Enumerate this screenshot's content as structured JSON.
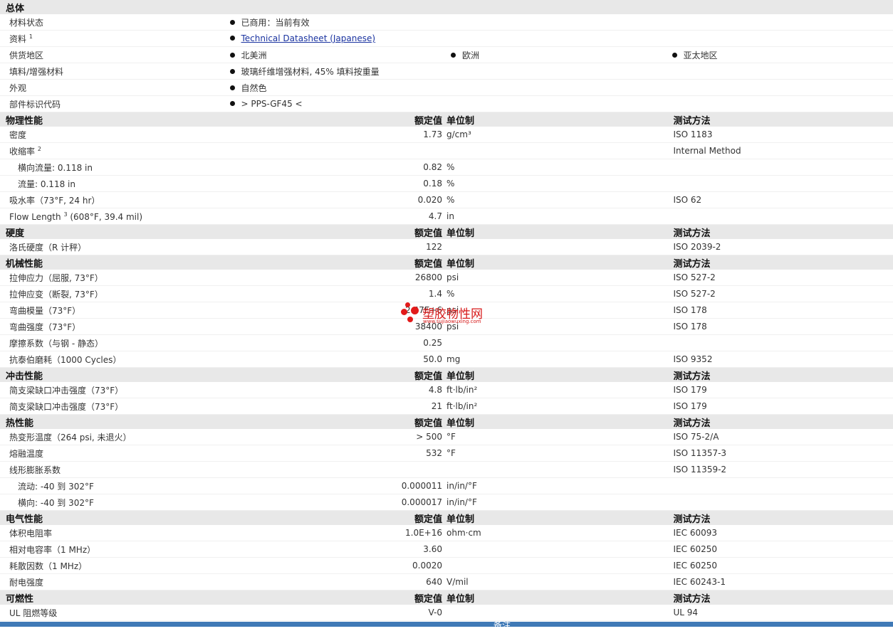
{
  "general": {
    "title": "总体",
    "rows": [
      {
        "label": "材料状态",
        "value": "已商用：当前有效"
      },
      {
        "label": "资料",
        "sup": "1",
        "link": "Technical Datasheet (Japanese)"
      },
      {
        "label": "供货地区",
        "regions": [
          "北美洲",
          "欧洲",
          "亚太地区"
        ]
      },
      {
        "label": "填料/增强材料",
        "value": "玻璃纤维增强材料, 45% 填料按重量"
      },
      {
        "label": "外观",
        "value": "自然色"
      },
      {
        "label": "部件标识代码",
        "value": "> PPS-GF45 <"
      }
    ]
  },
  "headers": {
    "value": "额定值",
    "unit": "单位制",
    "method": "测试方法"
  },
  "sections": [
    {
      "title": "物理性能",
      "rows": [
        {
          "label": "密度",
          "value": "1.73",
          "unit": "g/cm³",
          "method": "ISO 1183"
        },
        {
          "label": "收缩率",
          "sup": "2",
          "value": "",
          "unit": "",
          "method": "Internal Method"
        },
        {
          "label": "横向流量: 0.118 in",
          "indent": true,
          "value": "0.82",
          "unit": "%",
          "method": ""
        },
        {
          "label": "流量: 0.118 in",
          "indent": true,
          "value": "0.18",
          "unit": "%",
          "method": ""
        },
        {
          "label": "吸水率（73°F, 24 hr）",
          "value": "0.020",
          "unit": "%",
          "method": "ISO 62"
        },
        {
          "label": "Flow Length",
          "sup": "3",
          "suffix": " (608°F, 39.4 mil)",
          "value": "4.7",
          "unit": "in",
          "method": ""
        }
      ]
    },
    {
      "title": "硬度",
      "rows": [
        {
          "label": "洛氏硬度（R 计秤）",
          "value": "122",
          "unit": "",
          "method": "ISO 2039-2"
        }
      ]
    },
    {
      "title": "机械性能",
      "rows": [
        {
          "label": "拉伸应力（屈服, 73°F）",
          "value": "26800",
          "unit": "psi",
          "method": "ISO 527-2"
        },
        {
          "label": "拉伸应变（断裂, 73°F）",
          "value": "1.4",
          "unit": "%",
          "method": "ISO 527-2"
        },
        {
          "label": "弯曲模量（73°F）",
          "value": "2.47E+6",
          "unit": "psi",
          "method": "ISO 178"
        },
        {
          "label": "弯曲强度（73°F）",
          "value": "38400",
          "unit": "psi",
          "method": "ISO 178"
        },
        {
          "label": "摩擦系数（与钢 - 静态）",
          "value": "0.25",
          "unit": "",
          "method": ""
        },
        {
          "label": "抗泰伯磨耗（1000 Cycles）",
          "value": "50.0",
          "unit": "mg",
          "method": "ISO 9352"
        }
      ]
    },
    {
      "title": "冲击性能",
      "rows": [
        {
          "label": "简支梁缺口冲击强度（73°F）",
          "value": "4.8",
          "unit": "ft·lb/in²",
          "method": "ISO 179"
        },
        {
          "label": "简支梁缺口冲击强度（73°F）",
          "value": "21",
          "unit": "ft·lb/in²",
          "method": "ISO 179"
        }
      ]
    },
    {
      "title": "热性能",
      "rows": [
        {
          "label": "热变形温度（264 psi, 未退火）",
          "value": "> 500",
          "unit": "°F",
          "method": "ISO 75-2/A"
        },
        {
          "label": "熔融温度",
          "value": "532",
          "unit": "°F",
          "method": "ISO 11357-3"
        },
        {
          "label": "线形膨胀系数",
          "value": "",
          "unit": "",
          "method": "ISO 11359-2"
        },
        {
          "label": "流动: -40 到 302°F",
          "indent": true,
          "value": "0.000011",
          "unit": "in/in/°F",
          "method": ""
        },
        {
          "label": "横向: -40 到 302°F",
          "indent": true,
          "value": "0.000017",
          "unit": "in/in/°F",
          "method": ""
        }
      ]
    },
    {
      "title": "电气性能",
      "rows": [
        {
          "label": "体积电阻率",
          "value": "1.0E+16",
          "unit": "ohm·cm",
          "method": "IEC 60093"
        },
        {
          "label": "相对电容率（1 MHz）",
          "value": "3.60",
          "unit": "",
          "method": "IEC 60250"
        },
        {
          "label": "耗散因数（1 MHz）",
          "value": "0.0020",
          "unit": "",
          "method": "IEC 60250"
        },
        {
          "label": "耐电强度",
          "value": "640",
          "unit": "V/mil",
          "method": "IEC 60243-1"
        }
      ]
    },
    {
      "title": "可燃性",
      "rows": [
        {
          "label": "UL 阻燃等级",
          "value": "V-0",
          "unit": "",
          "method": "UL 94"
        }
      ]
    }
  ],
  "watermark": {
    "name": "塑胶物性网",
    "url": "www.sujiaowuxing.com"
  },
  "footer": {
    "label": "备注"
  }
}
